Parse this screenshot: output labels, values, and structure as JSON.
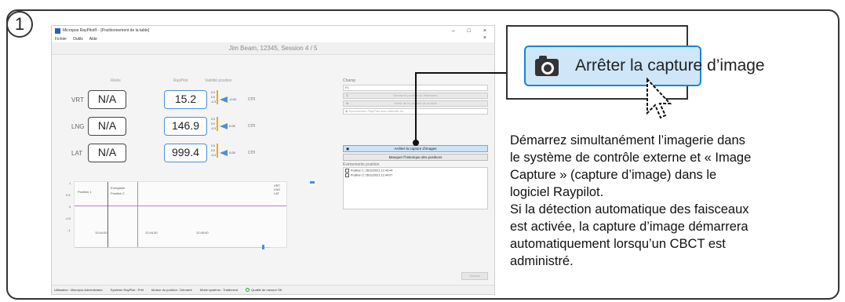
{
  "step": {
    "number": "1"
  },
  "window": {
    "title": "Micropos RayPilot® - [Positionnement de la table]",
    "controls": [
      "–",
      "□",
      "×"
    ],
    "menu": [
      "Fichier",
      "Outils",
      "Aide"
    ],
    "menu_close": "×",
    "patient": "Jim Beam, 12345, Session 4 / 5"
  },
  "columns": {
    "reels": "Réels",
    "raypilot": "RayPilot",
    "validite": "Validité position"
  },
  "rows": [
    {
      "label": "VRT",
      "reel": "N/A",
      "raypilot": "15.2",
      "pointer": "-0.02",
      "unit": "cm",
      "scale": [
        "0.3",
        "0.0",
        "-0.3"
      ]
    },
    {
      "label": "LNG",
      "reel": "N/A",
      "raypilot": "146.9",
      "pointer": "0.00",
      "unit": "cm",
      "scale": [
        "0.3",
        "0.0",
        "-0.3"
      ]
    },
    {
      "label": "LAT",
      "reel": "N/A",
      "raypilot": "999.4",
      "pointer": "0.00",
      "unit": "cm",
      "scale": [
        "0.3",
        "0.0",
        "-0.3"
      ]
    }
  ],
  "graph": {
    "yticks": [
      "1",
      "0.5",
      "0",
      "-0.5",
      "-1"
    ],
    "xticks": [
      "12:44:00",
      "12:44:30",
      "12:45:00"
    ],
    "markers": [
      "Position 1",
      "Enregistré",
      "Position 2"
    ],
    "legend": [
      "VRT",
      "LNG",
      "LAT"
    ]
  },
  "right_panel": {
    "champ_label": "Champ",
    "champ_value": "F1",
    "btn_traitement": "Démarrer position du traitement",
    "btn_sortie": "Sortie de la position de la table",
    "sync_value": "Synchroniser RayPilot avec Aktuelle tur",
    "btn_capture": "Arrêter la capture d'images",
    "btn_historique": "Masquer l'historique des positions",
    "events_label": "Événements position",
    "events": [
      "Position 1: 26/11/2021 12:43:44",
      "Position 2: 26/11/2021 12:44:07"
    ],
    "suivant": "Suivant"
  },
  "status": {
    "user": "Utilisateur : Micropos Administrator",
    "system": "Système RayPilot : Prêt",
    "motor": "Moteur du position : Démarré",
    "mode": "Mode système : Traitement",
    "quality": "Qualité de mesure OK"
  },
  "callout": {
    "button_label": "Arrêter la capture d’image",
    "icon": "camera-icon"
  },
  "description": [
    "Démarrez simultanément l’imagerie dans",
    "le système de contrôle externe et « Image",
    "Capture » (capture d’image) dans le",
    "logiciel Raypilot.",
    "Si la détection automatique des faisceaux",
    "est activée, la capture d’image démarrera",
    "automatiquement lorsqu’un CBCT est",
    "administré."
  ],
  "colors": {
    "accent": "#1a86d0",
    "active_bg": "#cfe6f9",
    "indicator": "#f0a81c",
    "ok": "#35a035"
  }
}
